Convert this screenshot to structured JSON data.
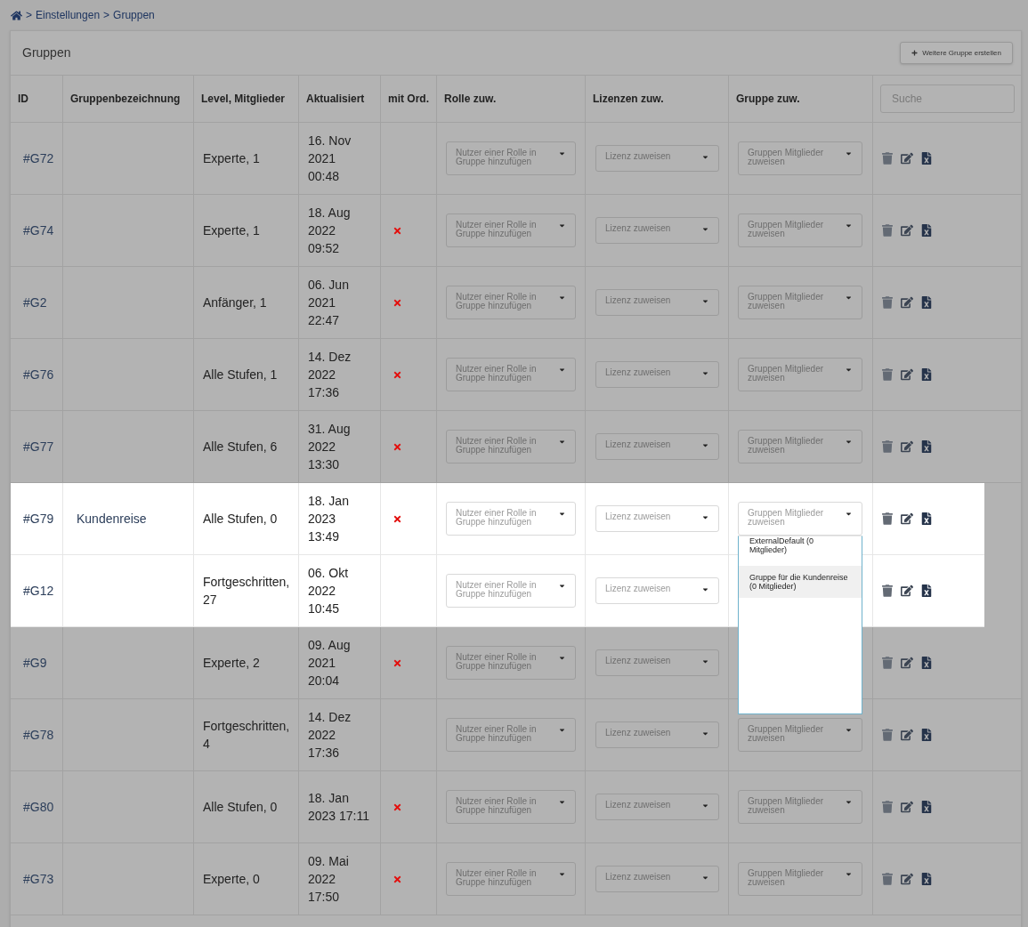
{
  "breadcrumb": {
    "items": [
      {
        "label": "Einstellungen"
      },
      {
        "label": "Gruppen"
      }
    ],
    "separator": ">"
  },
  "card": {
    "title": "Gruppen",
    "create_button": "Weitere Gruppe erstellen"
  },
  "table": {
    "columns": [
      "ID",
      "Gruppenbezeichnung",
      "Level, Mitglieder",
      "Aktualisiert",
      "mit Ord.",
      "Rolle zuw.",
      "Lizenzen zuw.",
      "Gruppe zuw."
    ],
    "search": {
      "placeholder": "Suche"
    },
    "rows": [
      {
        "id": "#G72",
        "level": "Experte, 1",
        "updated": [
          "16. Nov",
          "2021",
          "00:48"
        ],
        "x_mark": false,
        "highlighted": false,
        "role_placeholder": "Nutzer einer Rolle in Gruppe hinzufügen",
        "license_placeholder": "Lizenz zuweisen",
        "group_placeholder": "Gruppen Mitglieder zuweisen"
      },
      {
        "id": "#G74",
        "level": "Experte, 1",
        "updated": [
          "18. Aug",
          "2022",
          "09:52"
        ],
        "x_mark": true,
        "highlighted": false,
        "role_placeholder": "Nutzer einer Rolle in Gruppe hinzufügen",
        "license_placeholder": "Lizenz zuweisen",
        "group_placeholder": "Gruppen Mitglieder zuweisen"
      },
      {
        "id": "#G2",
        "level": "Anfänger, 1",
        "updated": [
          "06. Jun",
          "2021",
          "22:47"
        ],
        "x_mark": true,
        "highlighted": false,
        "role_placeholder": "Nutzer einer Rolle in Gruppe hinzufügen",
        "license_placeholder": "Lizenz zuweisen",
        "group_placeholder": "Gruppen Mitglieder zuweisen"
      },
      {
        "id": "#G76",
        "level": "Alle Stufen, 1",
        "updated": [
          "14. Dez",
          "2022",
          "17:36"
        ],
        "x_mark": true,
        "highlighted": false,
        "role_placeholder": "Nutzer einer Rolle in Gruppe hinzufügen",
        "license_placeholder": "Lizenz zuweisen",
        "group_placeholder": "Gruppen Mitglieder zuweisen"
      },
      {
        "id": "#G77",
        "level": "Alle Stufen, 6",
        "updated": [
          "31. Aug",
          "2022",
          "13:30"
        ],
        "x_mark": true,
        "highlighted": false,
        "role_placeholder": "Nutzer einer Rolle in Gruppe hinzufügen",
        "license_placeholder": "Lizenz zuweisen",
        "group_placeholder": "Gruppen Mitglieder zuweisen"
      },
      {
        "id": "#G79",
        "name": "Kundenreise",
        "level": "Alle Stufen, 0",
        "updated": [
          "18. Jan",
          "2023",
          "13:49"
        ],
        "x_mark": true,
        "highlighted": true,
        "role_placeholder": "Nutzer einer Rolle in Gruppe hinzufügen",
        "license_placeholder": "Lizenz zuweisen",
        "group_placeholder": "Gruppen Mitglieder zuweisen",
        "group_dropdown": {
          "expanded": true,
          "options": [
            {
              "label": "ExternalDefault (0 Mitglieder)",
              "selected": false
            },
            {
              "label": "Gruppe für die Kundenreise (0 Mitglieder)",
              "selected": true
            }
          ]
        }
      },
      {
        "id": "#G12",
        "level": "Fortgeschritten, 27",
        "updated": [
          "06. Okt",
          "2022",
          "10:45"
        ],
        "x_mark": false,
        "highlighted": true,
        "role_placeholder": "Nutzer einer Rolle in Gruppe hinzufügen",
        "license_placeholder": "Lizenz zuweisen"
      },
      {
        "id": "#G9",
        "level": "Experte, 2",
        "updated": [
          "09. Aug",
          "2021",
          "20:04"
        ],
        "x_mark": true,
        "highlighted": false,
        "role_placeholder": "Nutzer einer Rolle in Gruppe hinzufügen",
        "license_placeholder": "Lizenz zuweisen"
      },
      {
        "id": "#G78",
        "level": "Fortgeschritten, 4",
        "updated": [
          "14. Dez",
          "2022",
          "17:36"
        ],
        "x_mark": false,
        "highlighted": false,
        "role_placeholder": "Nutzer einer Rolle in Gruppe hinzufügen",
        "license_placeholder": "Lizenz zuweisen",
        "group_placeholder": "Gruppen Mitglieder zuweisen"
      },
      {
        "id": "#G80",
        "level": "Alle Stufen, 0",
        "updated": [
          "18. Jan",
          "2023 17:11"
        ],
        "x_mark": true,
        "highlighted": false,
        "role_placeholder": "Nutzer einer Rolle in Gruppe hinzufügen",
        "license_placeholder": "Lizenz zuweisen",
        "group_placeholder": "Gruppen Mitglieder zuweisen"
      },
      {
        "id": "#G73",
        "level": "Experte, 0",
        "updated": [
          "09. Mai",
          "2022",
          "17:50"
        ],
        "x_mark": true,
        "highlighted": false,
        "role_placeholder": "Nutzer einer Rolle in Gruppe hinzufügen",
        "license_placeholder": "Lizenz zuweisen",
        "group_placeholder": "Gruppen Mitglieder zuweisen"
      }
    ]
  }
}
